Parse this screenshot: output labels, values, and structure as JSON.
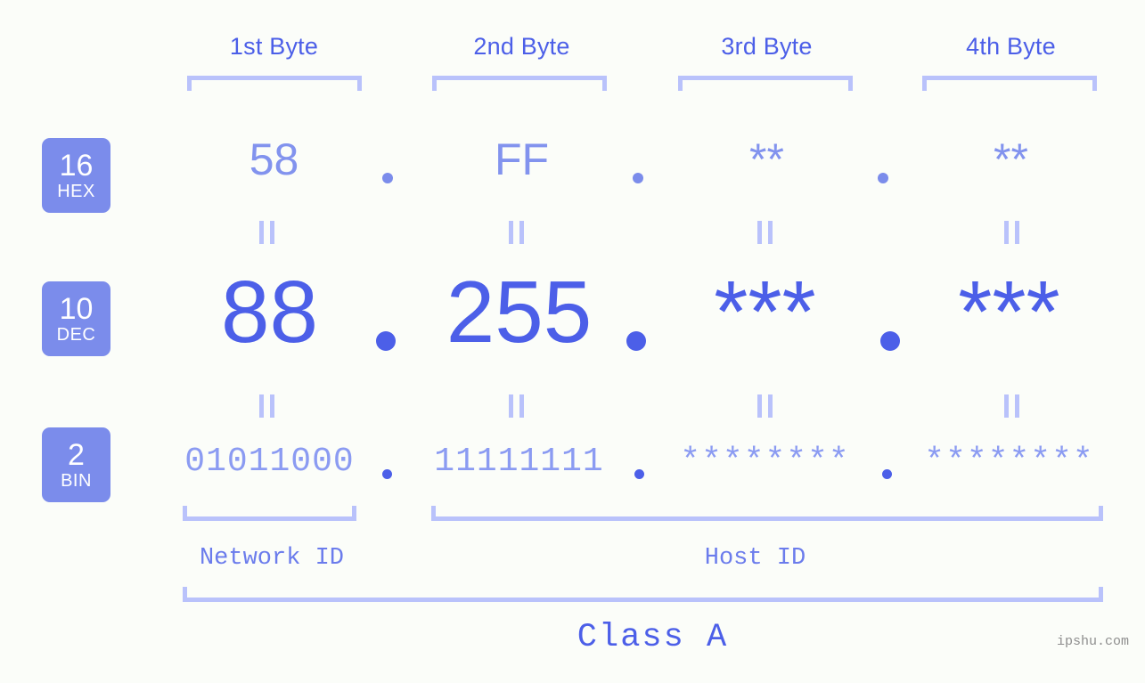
{
  "meta": {
    "background_color": "#fbfdf9",
    "accent_color": "#4c5fe8",
    "light_accent_color": "#b9c2fb",
    "badge_color": "#7b8ceb",
    "watermark": "ipshu.com"
  },
  "byte_headers": [
    {
      "label": "1st Byte"
    },
    {
      "label": "2nd Byte"
    },
    {
      "label": "3rd Byte"
    },
    {
      "label": "4th Byte"
    }
  ],
  "radix_rows": [
    {
      "base": "16",
      "name": "HEX"
    },
    {
      "base": "10",
      "name": "DEC"
    },
    {
      "base": "2",
      "name": "BIN"
    }
  ],
  "rows": {
    "hex": {
      "values": [
        "58",
        "FF",
        "**",
        "**"
      ],
      "separator": "."
    },
    "dec": {
      "values": [
        "88",
        "255",
        "***",
        "***"
      ],
      "separator": "."
    },
    "bin": {
      "values": [
        "01011000",
        "11111111",
        "********",
        "********"
      ],
      "separator": "."
    }
  },
  "equality_mark": "||",
  "segments": {
    "network_id": "Network ID",
    "host_id": "Host ID"
  },
  "class": {
    "label": "Class A"
  }
}
